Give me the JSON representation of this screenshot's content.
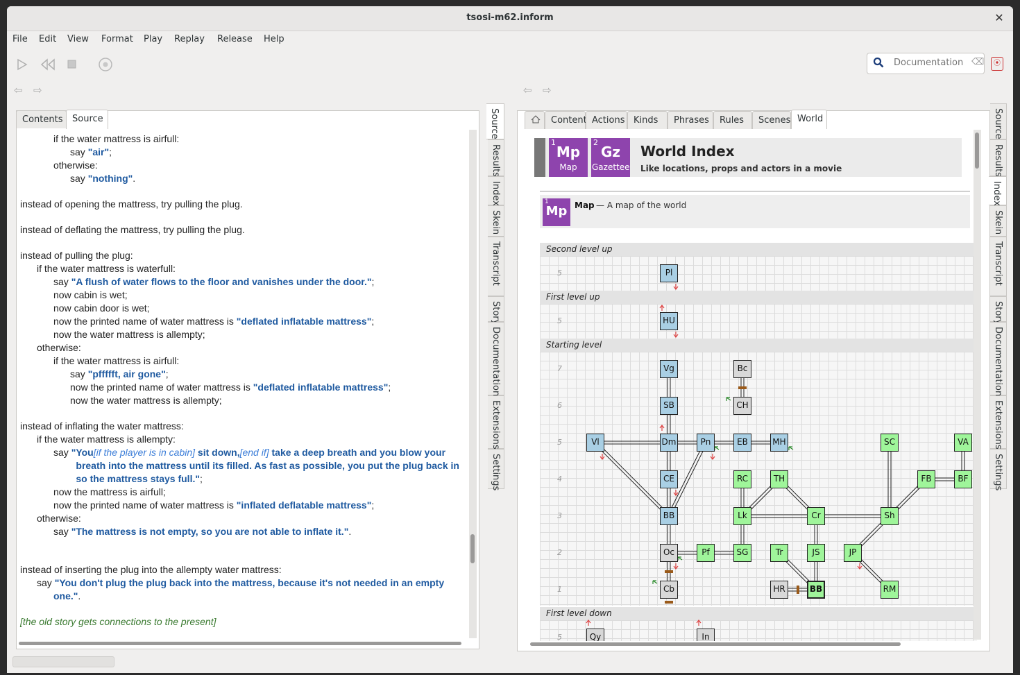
{
  "window": {
    "title": "tsosi-m62.inform",
    "close": "✕"
  },
  "menu": [
    "File",
    "Edit",
    "View",
    "Format",
    "Play",
    "Replay",
    "Release",
    "Help"
  ],
  "search": {
    "placeholder": "Documentation"
  },
  "left": {
    "tabs": [
      "Contents",
      "Source"
    ],
    "side_tabs": [
      "Source",
      "Results",
      "Index",
      "Skein",
      "Transcript",
      "Story",
      "Documentation",
      "Extensions",
      "Settings"
    ],
    "lines": [
      {
        "indent": 2,
        "parts": [
          {
            "t": "if the water mattress is airfull:"
          }
        ]
      },
      {
        "indent": 3,
        "parts": [
          {
            "t": "say "
          },
          {
            "s": "\"air\""
          },
          {
            "t": ";"
          }
        ]
      },
      {
        "indent": 2,
        "parts": [
          {
            "t": "otherwise:"
          }
        ]
      },
      {
        "indent": 3,
        "parts": [
          {
            "t": "say "
          },
          {
            "s": "\"nothing\""
          },
          {
            "t": "."
          }
        ]
      },
      {
        "indent": 0,
        "parts": [
          {
            "t": "instead of opening the mattress, try pulling the plug."
          }
        ]
      },
      {
        "indent": 0,
        "parts": [
          {
            "t": "instead of deflating the mattress, try pulling the plug."
          }
        ]
      },
      {
        "indent": 0,
        "parts": [
          {
            "t": "instead of pulling the plug:"
          }
        ]
      },
      {
        "indent": 1,
        "parts": [
          {
            "t": "if the water mattress is waterfull:"
          }
        ]
      },
      {
        "indent": 2,
        "parts": [
          {
            "t": "say "
          },
          {
            "s": "\"A flush of water flows to the floor and vanishes under the door.\""
          },
          {
            "t": ";"
          }
        ]
      },
      {
        "indent": 2,
        "parts": [
          {
            "t": "now cabin is wet;"
          }
        ]
      },
      {
        "indent": 2,
        "parts": [
          {
            "t": "now cabin door is wet;"
          }
        ]
      },
      {
        "indent": 2,
        "parts": [
          {
            "t": "now the printed name of water mattress is "
          },
          {
            "s": "\"deflated inflatable mattress\""
          },
          {
            "t": ";"
          }
        ]
      },
      {
        "indent": 2,
        "parts": [
          {
            "t": "now the water mattress is allempty;"
          }
        ]
      },
      {
        "indent": 1,
        "parts": [
          {
            "t": "otherwise:"
          }
        ]
      },
      {
        "indent": 2,
        "parts": [
          {
            "t": "if the water mattress is airfull:"
          }
        ]
      },
      {
        "indent": 3,
        "parts": [
          {
            "t": "say "
          },
          {
            "s": "\"pffffft, air gone\""
          },
          {
            "t": ";"
          }
        ]
      },
      {
        "indent": 3,
        "parts": [
          {
            "t": "now the printed name of water mattress is "
          },
          {
            "s": "\"deflated inflatable mattress\""
          },
          {
            "t": ";"
          }
        ]
      },
      {
        "indent": 3,
        "parts": [
          {
            "t": "now the water mattress is allempty;"
          }
        ]
      },
      {
        "indent": 0,
        "parts": [
          {
            "t": "instead of inflating the water mattress:"
          }
        ]
      },
      {
        "indent": 1,
        "parts": [
          {
            "t": "if the water mattress is allempty:"
          }
        ]
      },
      {
        "indent": 2,
        "parts": [
          {
            "t": "say "
          },
          {
            "s": "\"You"
          },
          {
            "i": "[if the player is in cabin]"
          },
          {
            "s": " sit down,"
          },
          {
            "i": "[end if]"
          },
          {
            "s": " take a deep breath and you blow your"
          }
        ]
      },
      {
        "indent": 3.35,
        "parts": [
          {
            "s": "breath into the mattress until its filled. As fast as possible, you put the plug back in"
          }
        ]
      },
      {
        "indent": 3.35,
        "parts": [
          {
            "s": "so the mattress stays full.\""
          },
          {
            "t": ";"
          }
        ]
      },
      {
        "indent": 2,
        "parts": [
          {
            "t": "now the mattress is airfull;"
          }
        ]
      },
      {
        "indent": 2,
        "parts": [
          {
            "t": "now the printed name of water mattress is "
          },
          {
            "s": "\"inflated deflatable mattress\""
          },
          {
            "t": ";"
          }
        ]
      },
      {
        "indent": 1,
        "parts": [
          {
            "t": "otherwise:"
          }
        ]
      },
      {
        "indent": 2,
        "parts": [
          {
            "t": "say "
          },
          {
            "s": "\"The mattress is not empty, so you are not able to inflate it.\""
          },
          {
            "t": "."
          }
        ]
      },
      {
        "indent": 0,
        "parts": [
          {
            "t": "instead of inserting the plug into the allempty water mattress:"
          }
        ]
      },
      {
        "indent": 1,
        "parts": [
          {
            "t": "say "
          },
          {
            "s": "\"You don't plug the plug back into the mattress, because it's not needed in an empty"
          }
        ]
      },
      {
        "indent": 2,
        "parts": [
          {
            "s": "one.\""
          },
          {
            "t": "."
          }
        ]
      },
      {
        "indent": 0,
        "parts": [
          {
            "c": "[the old story gets connections to the present]"
          }
        ]
      }
    ]
  },
  "right": {
    "tabs": [
      "Contents",
      "Actions",
      "Kinds",
      "Phrases",
      "Rules",
      "Scenes",
      "World"
    ],
    "side_tabs": [
      "Source",
      "Results",
      "Index",
      "Skein",
      "Transcript",
      "Story",
      "Documentation",
      "Extensions",
      "Settings"
    ],
    "header": {
      "title": "World Index",
      "subtitle": "Like locations, props and actors in a movie",
      "icons": [
        {
          "num": "1",
          "abbr": "Mp",
          "label": "Map"
        },
        {
          "num": "2",
          "abbr": "Gz",
          "label": "Gazetteer"
        }
      ]
    },
    "map_entry": {
      "num": "1",
      "abbr": "Mp",
      "title": "Map",
      "desc": " — A map of the world"
    },
    "levels": [
      "Second level up",
      "First level up",
      "Starting level",
      "First level down"
    ],
    "rooms": [
      {
        "id": "Pl",
        "color": "blue"
      },
      {
        "id": "HU",
        "color": "blue"
      },
      {
        "id": "Vg",
        "color": "blue"
      },
      {
        "id": "Bc",
        "color": "grey"
      },
      {
        "id": "SB",
        "color": "blue"
      },
      {
        "id": "CH",
        "color": "grey"
      },
      {
        "id": "Vl",
        "color": "blue"
      },
      {
        "id": "Dm",
        "color": "blue"
      },
      {
        "id": "Pn",
        "color": "blue"
      },
      {
        "id": "EB",
        "color": "blue"
      },
      {
        "id": "MH",
        "color": "blue"
      },
      {
        "id": "SC",
        "color": "green"
      },
      {
        "id": "VA",
        "color": "green"
      },
      {
        "id": "CE",
        "color": "blue"
      },
      {
        "id": "RC",
        "color": "green"
      },
      {
        "id": "TH",
        "color": "green"
      },
      {
        "id": "FB",
        "color": "green"
      },
      {
        "id": "BF",
        "color": "green"
      },
      {
        "id": "BB",
        "color": "blue"
      },
      {
        "id": "Lk",
        "color": "green"
      },
      {
        "id": "Cr",
        "color": "green"
      },
      {
        "id": "Sh",
        "color": "green"
      },
      {
        "id": "Oc",
        "color": "grey"
      },
      {
        "id": "Pf",
        "color": "green"
      },
      {
        "id": "SG",
        "color": "green"
      },
      {
        "id": "Tr",
        "color": "green"
      },
      {
        "id": "JS",
        "color": "green"
      },
      {
        "id": "JP",
        "color": "green"
      },
      {
        "id": "Cb",
        "color": "grey"
      },
      {
        "id": "HR",
        "color": "grey"
      },
      {
        "id": "BB",
        "color": "green",
        "bold": true
      },
      {
        "id": "RM",
        "color": "green"
      },
      {
        "id": "Qy",
        "color": "grey"
      },
      {
        "id": "In",
        "color": "grey"
      }
    ],
    "row_numbers": [
      "5",
      "5",
      "7",
      "6",
      "5",
      "4",
      "3",
      "2",
      "1",
      "5"
    ]
  },
  "colors": {
    "accent": "#8e44ad",
    "string": "#1f5aa0",
    "comment": "#3a7a30",
    "blue_room": "#a9cfe4",
    "green_room": "#9ff59a",
    "grey_room": "#d8d8d8"
  }
}
